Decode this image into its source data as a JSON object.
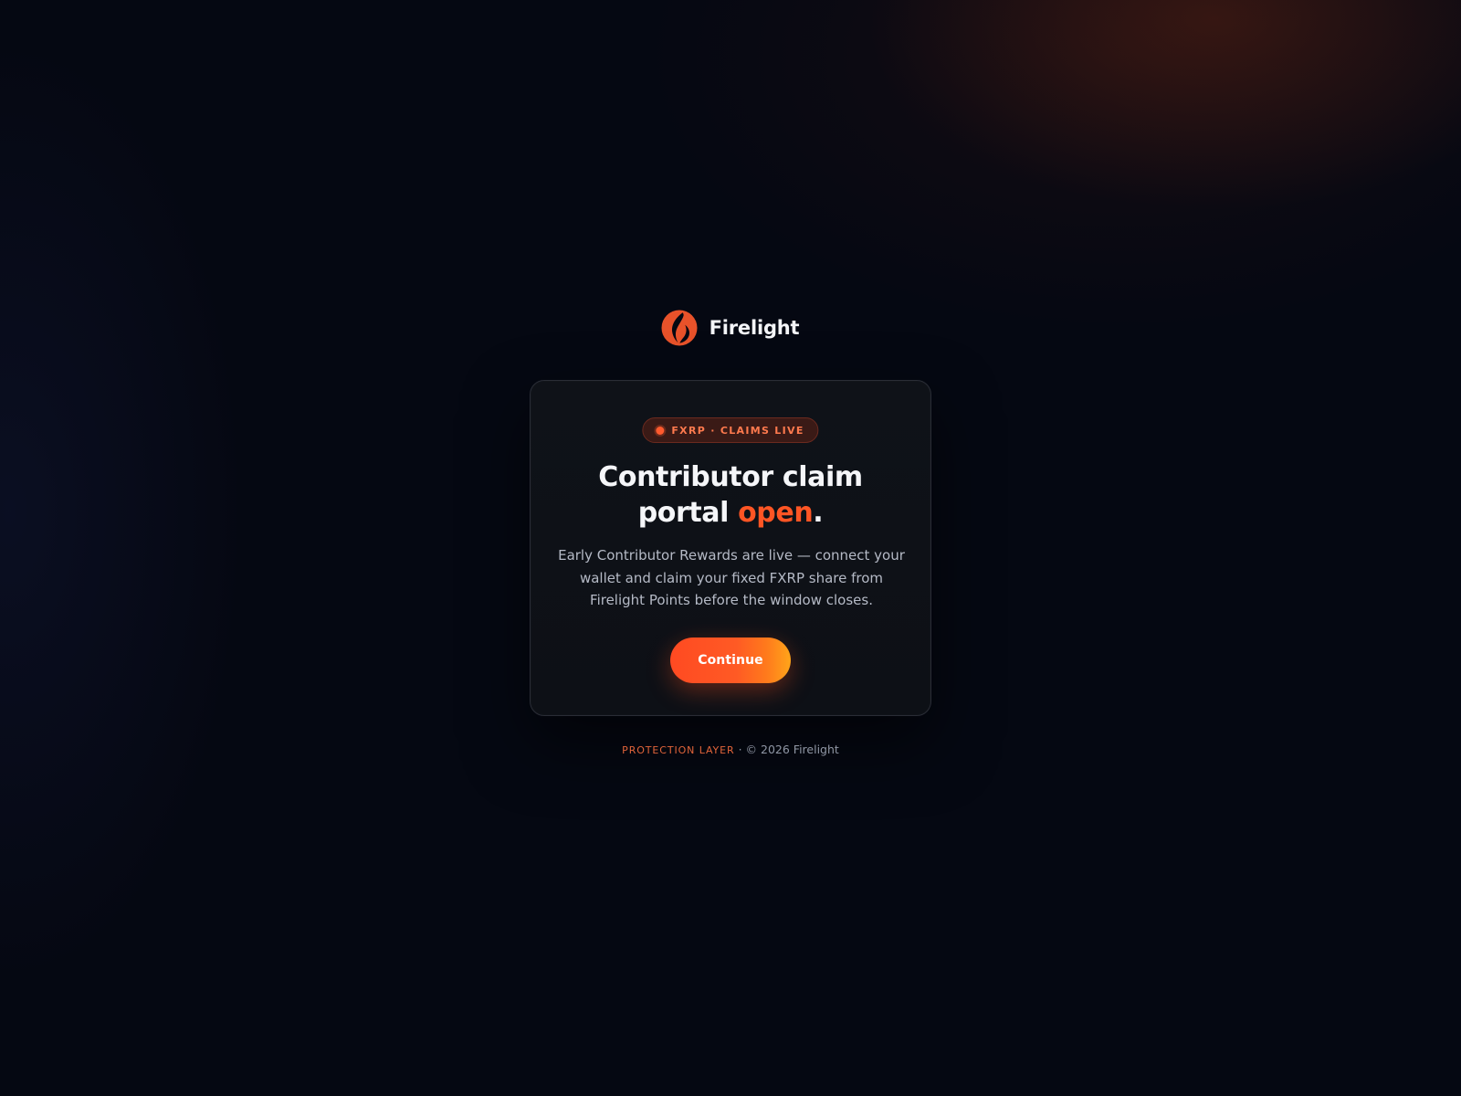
{
  "brand": {
    "name": "Firelight",
    "logo_icon": "firelight-flame-icon",
    "logo_color": "#e8522a"
  },
  "card": {
    "badge": {
      "text": "FXRP · CLAIMS LIVE",
      "dot_color": "#ff5a2e"
    },
    "headline": {
      "line1": "Contributor claim",
      "line2_prefix": "portal",
      "accent_word": "open",
      "suffix": "."
    },
    "description": "Early Contributor Rewards are live — connect your wallet and claim your fixed FXRP share from Firelight Points before the window closes.",
    "cta_label": "Continue"
  },
  "footer": {
    "tag": "PROTECTION LAYER",
    "separator": "·",
    "copyright": "© 2026 Firelight"
  },
  "colors": {
    "background": "#050812",
    "accent": "#ff5524",
    "button_gradient_start": "#ff4a22",
    "button_gradient_end": "#ffa51a",
    "card_background": "#0f1218"
  }
}
